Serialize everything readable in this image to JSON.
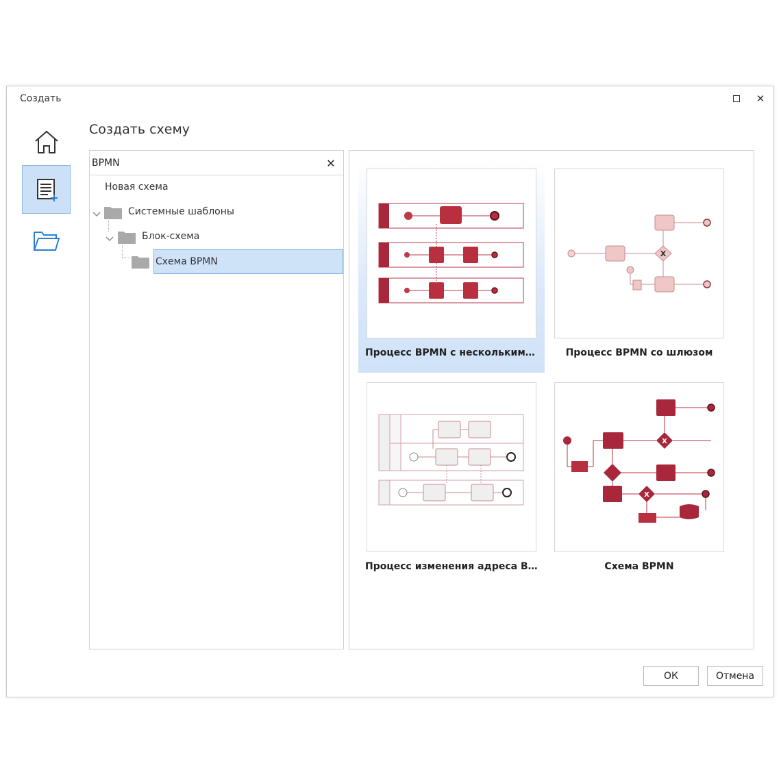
{
  "window": {
    "title": "Создать"
  },
  "main": {
    "heading": "Создать схему"
  },
  "search": {
    "value": "BPMN",
    "placeholder": ""
  },
  "tree": {
    "items": [
      {
        "label": "Новая схема"
      },
      {
        "label": "Системные шаблоны"
      },
      {
        "label": "Блок-схема"
      },
      {
        "label": "Схема BPMN"
      }
    ]
  },
  "templates": [
    {
      "label": "Процесс BPMN с несколькими пулами"
    },
    {
      "label": "Процесс BPMN со шлюзом"
    },
    {
      "label": "Процесс изменения адреса BPMN"
    },
    {
      "label": "Схема BPMN"
    }
  ],
  "buttons": {
    "ok": "ОК",
    "cancel": "Отмена"
  },
  "colors": {
    "accent": "#a8273a",
    "selection": "#cfe3f8",
    "selection_border": "#7fb0e3"
  },
  "icons": {
    "home": "home-icon",
    "new": "new-document-icon",
    "open": "open-folder-icon",
    "folder": "folder-icon",
    "close": "close-icon",
    "maximize": "maximize-icon"
  }
}
